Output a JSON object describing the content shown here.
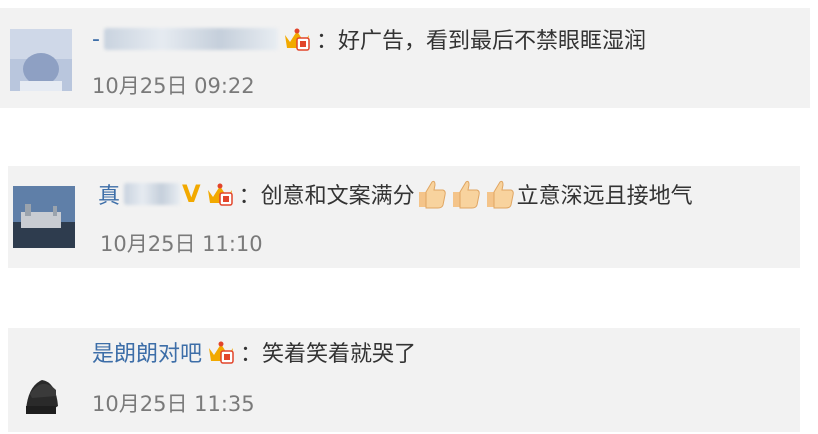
{
  "comments": [
    {
      "username_visible": "-",
      "message": "好广告，看到最后不禁眼眶湿润",
      "timestamp": "10月25日 09:22"
    },
    {
      "username_visible": "真",
      "message_before": "创意和文案满分",
      "message_after": "立意深远且接地气",
      "timestamp": "10月25日 11:10"
    },
    {
      "username_visible": "是朗朗对吧",
      "message": "笑着笑着就哭了",
      "timestamp": "10月25日 11:35"
    }
  ],
  "colors": {
    "username": "#3d6ea8",
    "card_bg": "#f2f2f2",
    "timestamp": "#7a7a7a",
    "text": "#333333",
    "vip_badge": "#f2a900"
  },
  "icons": [
    "vip-crown-icon",
    "verified-v-icon",
    "thumbs-up-icon"
  ]
}
